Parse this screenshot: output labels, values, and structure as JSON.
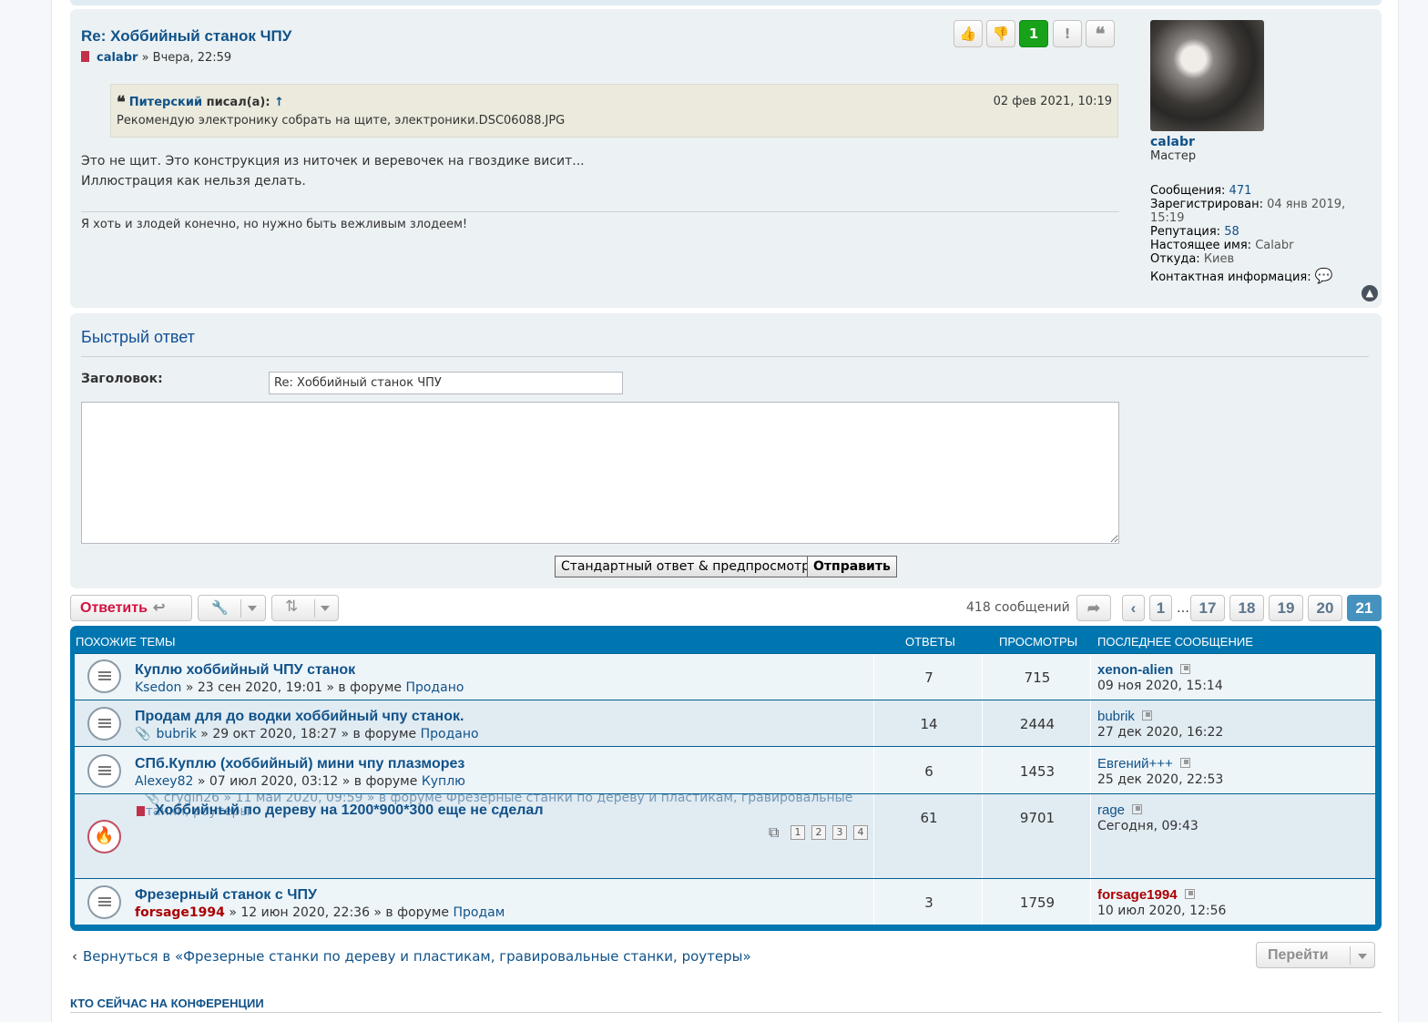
{
  "post": {
    "title": "Re: Хоббийный станок ЧПУ",
    "author": "calabr",
    "time": "» Вчера, 22:59",
    "score": "1",
    "quote": {
      "author": "Питерский",
      "wrote": "писал(а):",
      "arrow": "↑",
      "date": "02 фев 2021, 10:19",
      "text": "Рекомендую электронику собрать на щите, электроники.DSC06088.JPG"
    },
    "body_lines": [
      "Это не щит. Это конструкция из ниточек и веревочек на гвоздике висит...",
      "Иллюстрация как нельзя делать."
    ],
    "signature": "Я хоть и злодей конечно, но нужно быть вежливым злодеем!"
  },
  "profile": {
    "name": "calabr",
    "rank": "Мастер",
    "posts_label": "Сообщения:",
    "posts_value": "471",
    "registered_label": "Зарегистрирован:",
    "registered_value": "04 янв 2019,",
    "registered_value_2": "15:19",
    "rep_label": "Репутация:",
    "rep_value": "58",
    "realname_label": "Настоящее имя:",
    "realname_value": "Calabr",
    "from_label": "Откуда:",
    "from_value": "Киев",
    "contact_label": "Контактная информация:"
  },
  "quick_reply": {
    "title": "Быстрый ответ",
    "subject_label": "Заголовок:",
    "subject_value": "Re: Хоббийный станок ЧПУ",
    "preview_btn": "Стандартный ответ & предпросмотр",
    "submit_btn": "Отправить"
  },
  "bar": {
    "reply_label": "Ответить",
    "post_count": "418 сообщений",
    "pages": [
      "1",
      "17",
      "18",
      "19",
      "20",
      "21"
    ],
    "ellipsis": "…",
    "active_page": "21"
  },
  "similar": {
    "headers": {
      "topics": "ПОХОЖИЕ ТЕМЫ",
      "replies": "ОТВЕТЫ",
      "views": "ПРОСМОТРЫ",
      "last": "ПОСЛЕДНЕЕ СООБЩЕНИЕ"
    },
    "rows": [
      {
        "title": "Куплю хоббийный ЧПУ станок",
        "author": "Ksedon",
        "date": "» 23 сен 2020, 19:01 » в форуме",
        "forum": "Продано",
        "replies": "7",
        "views": "715",
        "last_user": "xenon-alien",
        "last_date": "09 ноя 2020, 15:14"
      },
      {
        "title": "Продам для до водки хоббийный чпу станок.",
        "author": "bubrik",
        "date": "» 29 окт 2020, 18:27 » в форуме",
        "forum": "Продано",
        "replies": "14",
        "views": "2444",
        "last_user": "bubrik",
        "last_date": "27 дек 2020, 16:22"
      },
      {
        "title": "СПб.Куплю (хоббийный) мини чпу плазморез",
        "author": "Alexey82",
        "date": "» 07 июл 2020, 03:12 » в форуме",
        "forum": "Куплю",
        "replies": "6",
        "views": "1453",
        "last_user": "Евгений+++",
        "last_date": "25 дек 2020, 22:53"
      },
      {
        "title": "Хоббийный по дереву на 1200*900*300 еще не сделал",
        "ghost_text": "crygin26 » 11 май 2020, 09:59 » в форуме Фрезерные станки по дереву и пластикам, гравировальные",
        "ghost_text_2": "станки, роутеры",
        "mini_pages": [
          "1",
          "2",
          "3",
          "4"
        ],
        "replies": "61",
        "views": "9701",
        "last_user": "rage",
        "last_date": "Сегодня, 09:43"
      },
      {
        "title": "Фрезерный станок с ЧПУ",
        "author": "forsage1994",
        "date": "» 12 июн 2020, 22:36 » в форуме",
        "forum": "Продам",
        "replies": "3",
        "views": "1759",
        "last_user": "forsage1994",
        "last_date": "10 июл 2020, 12:56"
      }
    ]
  },
  "footer": {
    "back_link": "Вернуться в «Фрезерные станки по дереву и пластикам, гравировальные станки, роутеры»",
    "jump_label": "Перейти",
    "online_title": "КТО СЕЙЧАС НА КОНФЕРЕНЦИИ"
  },
  "colors": {
    "link": "#105289",
    "post_bg": "#ecf1f3",
    "header_blue": "#0076b1",
    "score_green": "#18a21a",
    "reply_red": "#d31141",
    "active_page": "#4692bf"
  }
}
